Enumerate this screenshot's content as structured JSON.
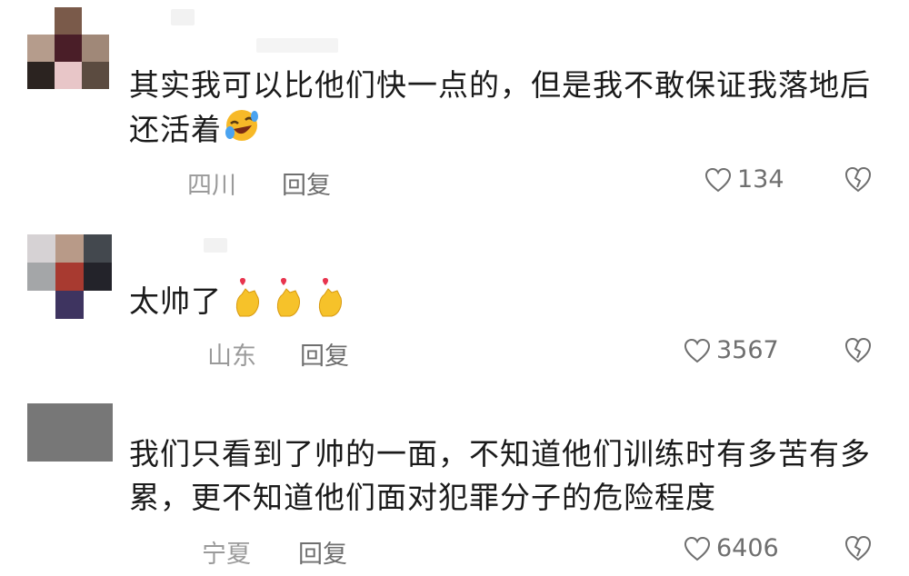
{
  "comments": [
    {
      "text": "其实我可以比他们快一点的，但是我不敢保证我落地后还活着",
      "location": "四川",
      "reply_label": "回复",
      "likes": "134",
      "emoji": "rofl-emoji"
    },
    {
      "text": "太帅了",
      "location": "山东",
      "reply_label": "回复",
      "likes": "3567",
      "emoji": "heart-hands-emoji"
    },
    {
      "text": "我们只看到了帅的一面，不知道他们训练时有多苦有多累，更不知道他们面对犯罪分子的危险程度",
      "location": "宁夏",
      "reply_label": "回复",
      "likes": "6406"
    }
  ],
  "colors": {
    "text": "#1a1a1a",
    "muted": "#9a9a9a",
    "action": "#6f6f6f"
  }
}
